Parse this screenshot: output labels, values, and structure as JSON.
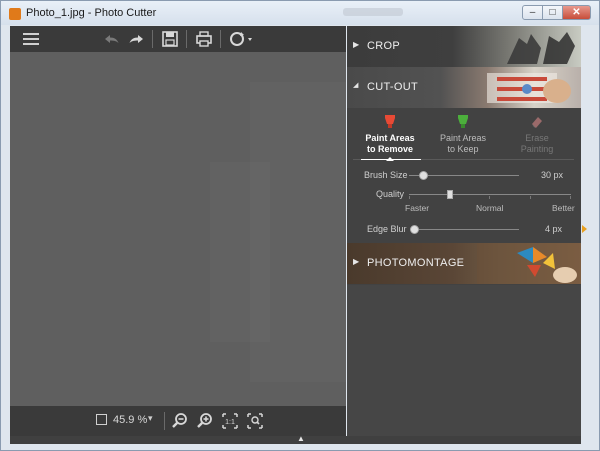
{
  "window": {
    "title": "Photo_1.jpg - Photo Cutter",
    "minimize_label": "–",
    "maximize_label": "□",
    "close_label": "✕"
  },
  "toolbar": {
    "menu_icon": "hamburger-menu-icon",
    "undo_icon": "undo-icon",
    "redo_icon": "redo-icon",
    "save_icon": "save-icon",
    "print_icon": "print-icon",
    "rotate_icon": "rotate-icon"
  },
  "statusbar": {
    "zoom_value": "45.9 %",
    "zoom_caret": "▾",
    "icons": [
      "zoom-out-icon",
      "zoom-in-icon",
      "actual-size-icon",
      "fit-to-window-icon"
    ]
  },
  "panel": {
    "crop": {
      "label": "CROP",
      "caret": "▶",
      "expanded": false
    },
    "cutout": {
      "label": "CUT-OUT",
      "caret": "◀",
      "expanded": true,
      "tools": [
        {
          "label_line1": "Paint Areas",
          "label_line2": "to Remove",
          "active": true,
          "color": "#e84a35"
        },
        {
          "label_line1": "Paint Areas",
          "label_line2": "to Keep",
          "active": false,
          "color": "#4caf3c"
        },
        {
          "label_line1": "Erase",
          "label_line2": "Painting",
          "active": false,
          "disabled": true,
          "color": "#c97a7a"
        }
      ],
      "brush_size": {
        "label": "Brush Size",
        "value": "30 px",
        "level": 0.03
      },
      "quality": {
        "label": "Quality",
        "faster": "Faster",
        "normal": "Normal",
        "better": "Better",
        "level": 0.25
      },
      "edge_blur": {
        "label": "Edge Blur",
        "value": "4 px",
        "level": 0.0
      }
    },
    "photomontage": {
      "label": "PHOTOMONTAGE",
      "caret": "▶",
      "expanded": false
    }
  },
  "colors": {
    "accent": "#e8a020",
    "panel_bg": "#424242",
    "canvas_bg": "#606060"
  }
}
